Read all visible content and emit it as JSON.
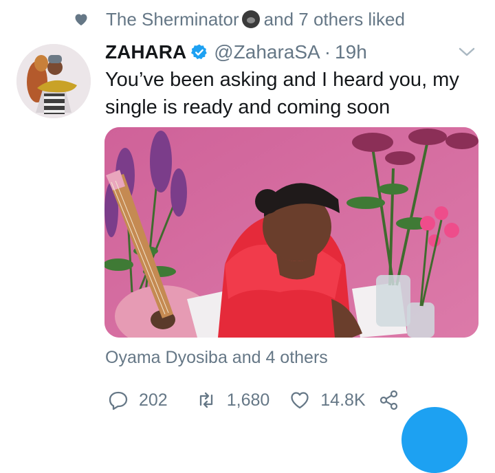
{
  "social_context": {
    "liker": "The Sherminator",
    "suffix": "and 7 others liked"
  },
  "tweet": {
    "name": "ZAHARA",
    "handle": "@ZaharaSA",
    "separator": "·",
    "time": "19h",
    "text_line1": "You’ve been asking and I heard you, my",
    "text_line2": "single is ready and coming soon",
    "liked_by": "Oyama Dyosiba and 4 others",
    "replies": "202",
    "retweets": "1,680",
    "likes": "14.8K"
  },
  "colors": {
    "accent": "#1da1f2",
    "secondary_text": "#657786",
    "media_background": "#d4689a"
  },
  "icons": {
    "social_context": "heart-icon",
    "verified": "verified-badge-icon",
    "menu": "chevron-down-icon",
    "reply": "reply-icon",
    "retweet": "retweet-icon",
    "like": "heart-icon",
    "share": "share-icon"
  }
}
